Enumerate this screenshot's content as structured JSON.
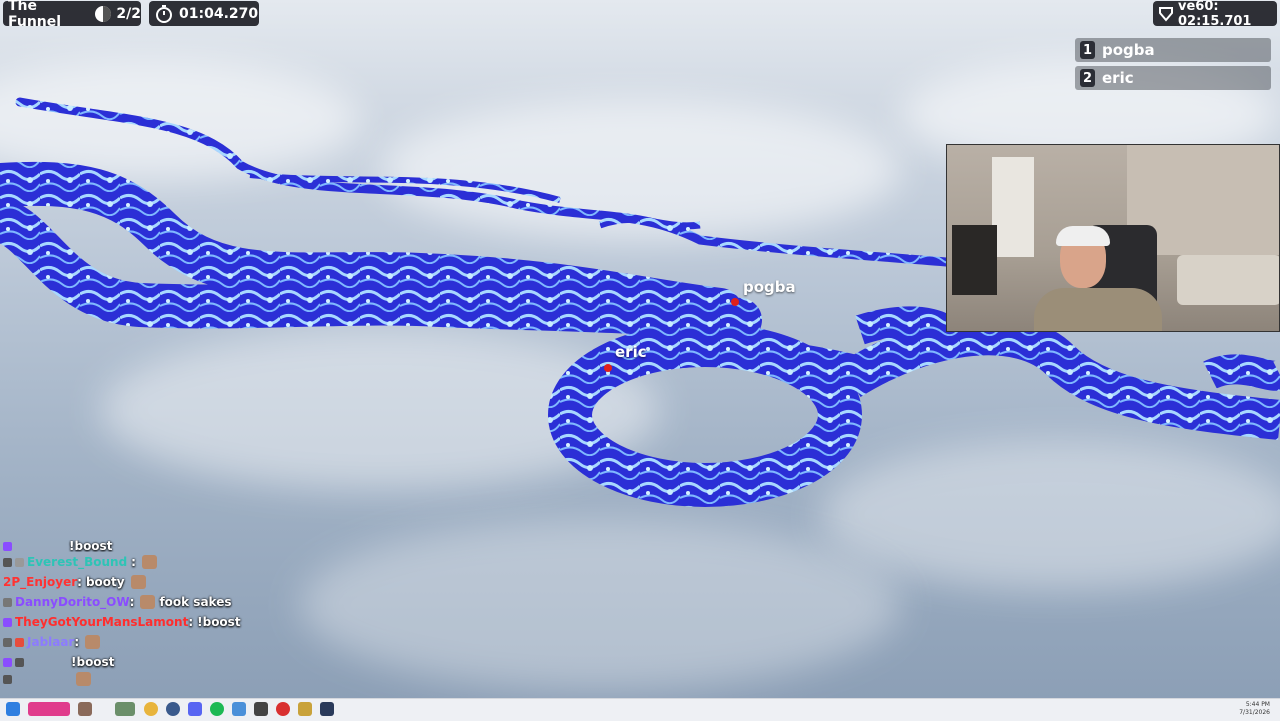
{
  "hud": {
    "map_name": "The Funnel",
    "lap": "2/2",
    "timer": "01:04.270",
    "world_record": "ve60: 02:15.701"
  },
  "leaderboard": [
    {
      "rank": "1",
      "name": "pogba"
    },
    {
      "rank": "2",
      "name": "eric"
    }
  ],
  "nametags": {
    "player1": "pogba",
    "player2": "eric"
  },
  "chat": [
    {
      "user": "",
      "message": "!boost",
      "color": "#9b59ff"
    },
    {
      "user": "Everest_Bound",
      "message": "",
      "color": "#2ec4b6"
    },
    {
      "user": "2P_Enjoyer",
      "message": "booty",
      "color": "#ff3333"
    },
    {
      "user": "DannyDorito_OW",
      "message": "fook sakes",
      "color": "#8a4dff"
    },
    {
      "user": "TheyGotYourMansLamont",
      "message": "!boost",
      "color": "#ff2e2e"
    },
    {
      "user": "Jablaar",
      "message": "",
      "color": "#8c7bff"
    },
    {
      "user": "",
      "message": "!boost",
      "color": "#ff3cbe"
    },
    {
      "user": "",
      "message": "",
      "color": "#66b3ff"
    }
  ],
  "taskbar": {
    "time": "5:44 PM",
    "date": "7/31/2026"
  },
  "colors": {
    "track_blue": "#2b2fd6",
    "track_highlight": "#a8d8ff",
    "hud_bg": "#16181e",
    "player_marker": "#e0201c"
  }
}
